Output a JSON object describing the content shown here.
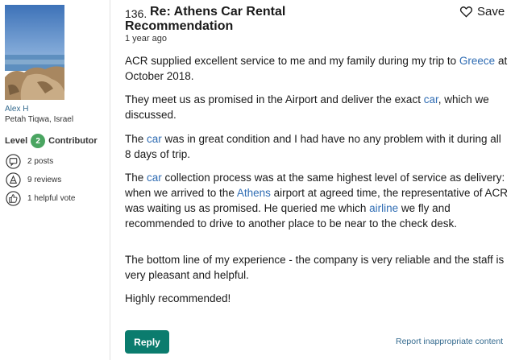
{
  "reviewer": {
    "name": "Alex H",
    "location": "Petah Tiqwa, Israel",
    "level_label": "Level",
    "level": "2",
    "level_title": "Contributor",
    "posts": "2 posts",
    "reviews": "9 reviews",
    "helpful_votes": "1 helpful vote"
  },
  "review": {
    "number": "136.",
    "title_line1": "Re: Athens Car Rental",
    "title_line2": "Recommendation",
    "date": "1 year ago",
    "save_label": "Save",
    "p1": [
      "ACR supplied excellent service to me and my family during my trip to ",
      "Greece",
      " at October 2018."
    ],
    "p2": [
      "They meet us as promised in the Airport and deliver the exact ",
      "car",
      ", which we discussed."
    ],
    "p3": [
      "The ",
      "car",
      " was in great condition and I had have no any problem with it during all 8 days of trip."
    ],
    "p4": [
      "The ",
      "car",
      " collection process was at the same highest level of service as delivery: when we arrived to the ",
      "Athens",
      " airport at agreed time, the representative of ACR was waiting us as promised. He queried me which ",
      "airline",
      " we fly and recommended to drive to another place to be near to the check desk."
    ],
    "p5": "The bottom line of my experience - the company is very reliable and the staff is very pleasant and helpful.",
    "p6": "Highly recommended!"
  },
  "actions": {
    "reply_label": "Reply",
    "report_label": "Report inappropriate content"
  },
  "icons": {
    "posts": "speech-bubble-icon",
    "reviews": "review-pen-icon",
    "helpful": "thumbs-up-icon",
    "save": "heart-icon"
  },
  "colors": {
    "link": "#2f6cb3",
    "level_badge": "#4aa561",
    "reply_button": "#0b7c6e"
  }
}
